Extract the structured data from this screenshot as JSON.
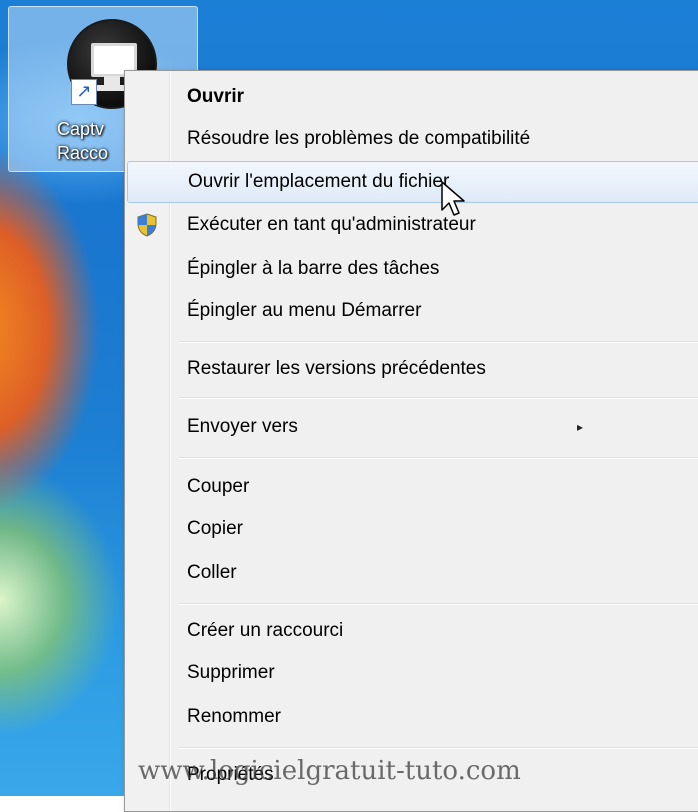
{
  "desktop_icon": {
    "name": "desktop-shortcut",
    "label_line1": "Captv",
    "label_line2": "Racco"
  },
  "context_menu": {
    "items": [
      {
        "label": "Ouvrir",
        "bold": true
      },
      {
        "label": "Résoudre les problèmes de compatibilité"
      },
      {
        "label": "Ouvrir l'emplacement du fichier",
        "highlighted": true
      },
      {
        "label": "Exécuter en tant qu'administrateur",
        "icon": "uac-shield-icon"
      },
      {
        "label": "Épingler à la barre des tâches"
      },
      {
        "label": "Épingler au menu Démarrer"
      },
      {
        "label": "Restaurer les versions précédentes"
      },
      {
        "label": "Envoyer vers",
        "submenu_arrow": "▸"
      },
      {
        "label": "Couper"
      },
      {
        "label": "Copier"
      },
      {
        "label": "Coller"
      },
      {
        "label": "Créer un raccourci"
      },
      {
        "label": "Supprimer"
      },
      {
        "label": "Renommer"
      },
      {
        "label": "Propriétés"
      }
    ]
  },
  "watermark": "www.logicielgratuit-tuto.com",
  "colors": {
    "desktop_blue": "#1c7fd6",
    "menu_background": "#f0f0f0",
    "hover_border": "#a8c8ec"
  }
}
